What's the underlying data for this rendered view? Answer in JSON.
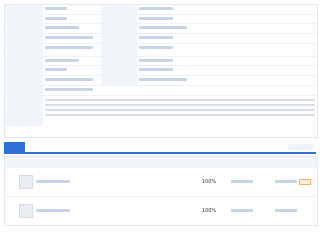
{
  "table": {
    "rows": [
      {
        "percent": "100%"
      },
      {
        "percent": "100%"
      }
    ]
  }
}
